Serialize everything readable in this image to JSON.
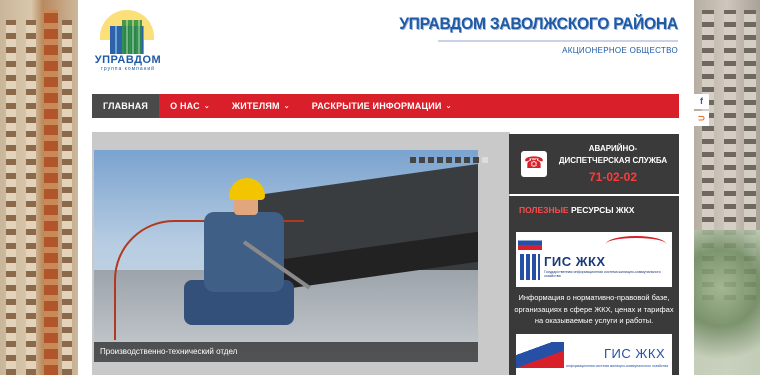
{
  "header": {
    "logo_word": "УПРАВДОМ",
    "logo_sub": "группа компаний",
    "title": "УПРАВДОМ ЗАВОЛЖСКОГО РАЙОНА",
    "subtitle": "АКЦИОНЕРНОЕ ОБЩЕСТВО"
  },
  "nav": {
    "items": [
      {
        "label": "ГЛАВНАЯ",
        "active": true,
        "dropdown": false
      },
      {
        "label": "О НАС",
        "active": false,
        "dropdown": true
      },
      {
        "label": "ЖИТЕЛЯМ",
        "active": false,
        "dropdown": true
      },
      {
        "label": "РАСКРЫТИЕ ИНФОРМАЦИИ",
        "active": false,
        "dropdown": true
      }
    ],
    "chevron": "⌄"
  },
  "social": {
    "facebook": "f",
    "rss": "⊃"
  },
  "slider": {
    "caption": "Производственно-технический отдел",
    "dots": 9,
    "active_dot": 8
  },
  "sidebar": {
    "emergency_line1": "АВАРИЙНО-",
    "emergency_line2": "ДИСПЕТЧЕРСКАЯ СЛУЖБА",
    "emergency_phone": "71-02-02",
    "resources_red": "ПОЛЕЗНЫЕ",
    "resources_rest": " РЕСУРСЫ ЖКХ",
    "gis_title": "ГИС ЖКХ",
    "gis_subtitle": "Государственная информационная система жилищно-коммунального хозяйства",
    "gis_text": "Информация о нормативно-правовой базе, организациях в сфере ЖКХ, ценах и тарифах на оказываемые услуги и работы.",
    "gis2_title": "ГИС ЖКХ",
    "gis2_subtitle": "информационная система жилищно-коммунального хозяйства"
  },
  "colors": {
    "accent": "#d9202a",
    "dark": "#3a3a3a",
    "brand_blue": "#1f5aa6"
  }
}
